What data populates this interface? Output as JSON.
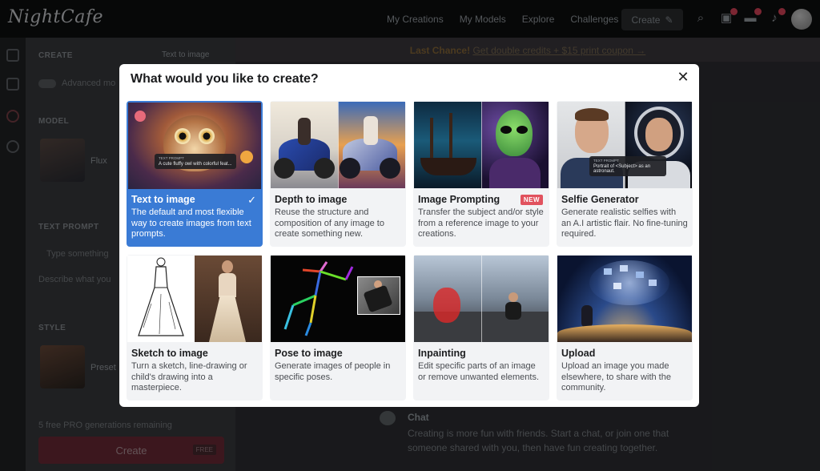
{
  "app": {
    "logo": "NightCafe",
    "nav": [
      "My Creations",
      "My Models",
      "Explore",
      "Challenges"
    ],
    "create_button": "Create"
  },
  "sidepanel": {
    "create_label": "CREATE",
    "mode_select": "Text to image",
    "advanced_label": "Advanced mo",
    "model_label": "MODEL",
    "model_name": "Flux",
    "text_prompt_label": "TEXT PROMPT",
    "prompt_placeholder": "Type something",
    "describe_hint": "Describe what you",
    "style_label": "STYLE",
    "style_name": "Preset",
    "pro_text": "5 free PRO generations remaining",
    "create_label_btn": "Create",
    "free_tag": "FREE"
  },
  "promo": {
    "bold": "Last Chance!",
    "link": "Get double credits + $15 print coupon →"
  },
  "chat": {
    "title": "Chat",
    "desc": "Creating is more fun with friends. Start a chat, or join one that someone shared with you, then have fun creating together."
  },
  "modal": {
    "title": "What would you like to create?",
    "close_icon": "close-icon",
    "cards": [
      {
        "title": "Text to image",
        "desc": "The default and most flexible way to create images from text prompts.",
        "selected": true,
        "prompt_header": "TEXT PROMPT",
        "prompt_text": "A cute fluffy owl with colorful feat..."
      },
      {
        "title": "Depth to image",
        "desc": "Reuse the structure and composition of any image to create something new."
      },
      {
        "title": "Image Prompting",
        "desc": "Transfer the subject and/or style from a reference image to your creations.",
        "badge": "NEW"
      },
      {
        "title": "Selfie Generator",
        "desc": "Generate realistic selfies with an A.I artistic flair. No fine-tuning required.",
        "prompt_header": "TEXT PROMPT",
        "prompt_text": "Portrait of <Subject> as an astronaut."
      },
      {
        "title": "Sketch to image",
        "desc": "Turn a sketch, line-drawing or child's drawing into a masterpiece."
      },
      {
        "title": "Pose to image",
        "desc": "Generate images of people in specific poses."
      },
      {
        "title": "Inpainting",
        "desc": "Edit specific parts of an image or remove unwanted elements."
      },
      {
        "title": "Upload",
        "desc": "Upload an image you made elsewhere, to share with the community."
      }
    ]
  },
  "colors": {
    "selected_card": "#3a7bd5",
    "new_badge": "#e1525e",
    "create_button": "#6e2b37"
  }
}
